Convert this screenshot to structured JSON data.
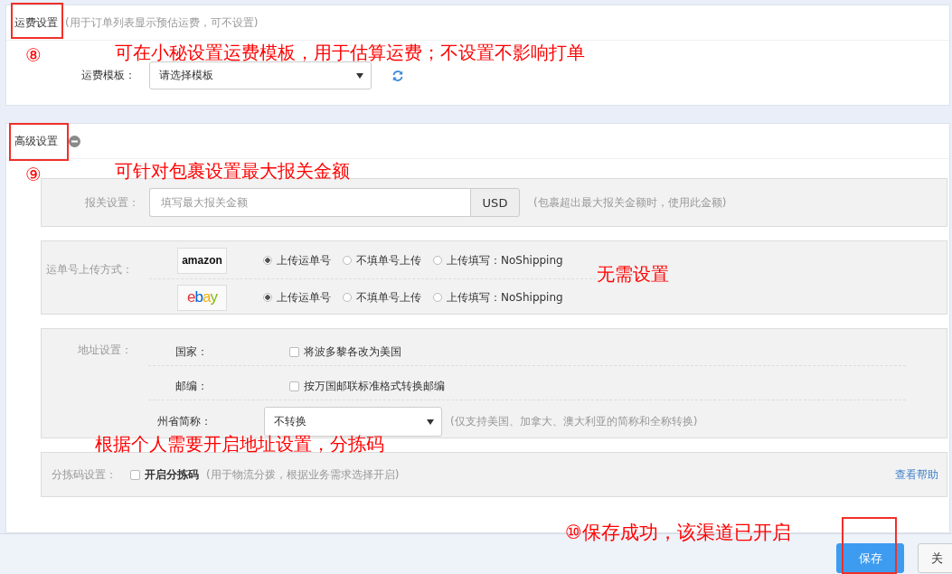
{
  "freight": {
    "title": "运费设置",
    "title_highlighted": true,
    "hint": "(用于订单列表显示预估运费，可不设置)",
    "note": "⑧",
    "note_text": "可在小秘设置运费模板，用于估算运费；不设置不影响打单",
    "template_label": "运费模板：",
    "template_value": "请选择模板"
  },
  "advanced": {
    "title": "高级设置",
    "title_highlighted": true,
    "expanded": true,
    "note": "⑨",
    "note_text": "可针对包裹设置最大报关金额",
    "customs": {
      "label": "报关设置：",
      "placeholder": "填写最大报关金额",
      "currency": "USD",
      "hint": "(包裹超出最大报关金额时，使用此金额)"
    },
    "upload": {
      "label": "运单号上传方式：",
      "note": "无需设置",
      "platforms": [
        {
          "logo": "amazon",
          "options": [
            {
              "label": "上传运单号",
              "selected": true
            },
            {
              "label": "不填单号上传",
              "selected": false
            },
            {
              "label": "上传填写：NoShipping",
              "selected": false
            }
          ]
        },
        {
          "logo": "ebay",
          "options": [
            {
              "label": "上传运单号",
              "selected": true
            },
            {
              "label": "不填单号上传",
              "selected": false
            },
            {
              "label": "上传填写：NoShipping",
              "selected": false
            }
          ]
        }
      ]
    },
    "address": {
      "label": "地址设置：",
      "country_label": "国家：",
      "country_option": "将波多黎各改为美国",
      "country_checked": false,
      "zip_label": "邮编：",
      "zip_option": "按万国邮联标准格式转换邮编",
      "zip_checked": false,
      "state_label": "州省简称：",
      "state_value": "不转换",
      "state_hint": "(仅支持美国、加拿大、澳大利亚的简称和全称转换)"
    },
    "note2": "根据个人需要开启地址设置，分拣码",
    "sorting": {
      "label": "分拣码设置：",
      "option": "开启分拣码",
      "checked": false,
      "hint": "(用于物流分拨，根据业务需求选择开启)",
      "help_link": "查看帮助"
    }
  },
  "footer": {
    "note": "⑩保存成功，该渠道已开启",
    "save_highlighted": true,
    "buttons": [
      "保存",
      "关"
    ]
  }
}
